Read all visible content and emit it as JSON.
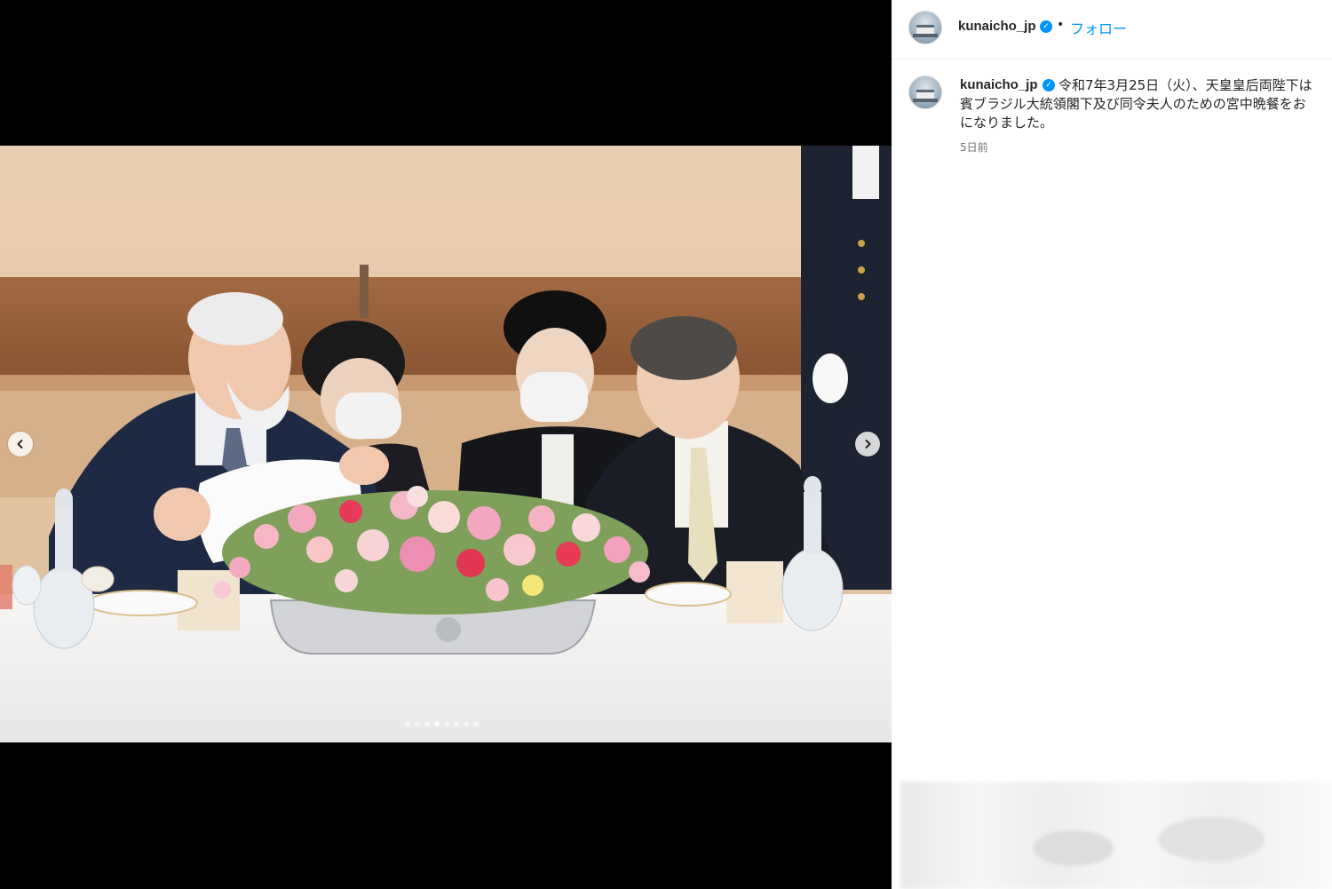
{
  "post": {
    "username": "kunaicho_jp",
    "follow_label": "フォロー",
    "bullet": "•",
    "verified_glyph": "✓",
    "caption_lines": [
      "令和7年3月25日（火）、天皇皇后両陛下は",
      "賓ブラジル大統領閣下及び同令夫人のための宮中晩餐をお",
      "になりました。"
    ],
    "timestamp": "5日前"
  },
  "carousel": {
    "dot_count": 8,
    "active_index": 3
  },
  "colors": {
    "accent": "#0095f6",
    "media_background": "#000000"
  },
  "icons": {
    "prev": "chevron-left-icon",
    "next": "chevron-right-icon",
    "verified": "verified-badge-icon"
  }
}
